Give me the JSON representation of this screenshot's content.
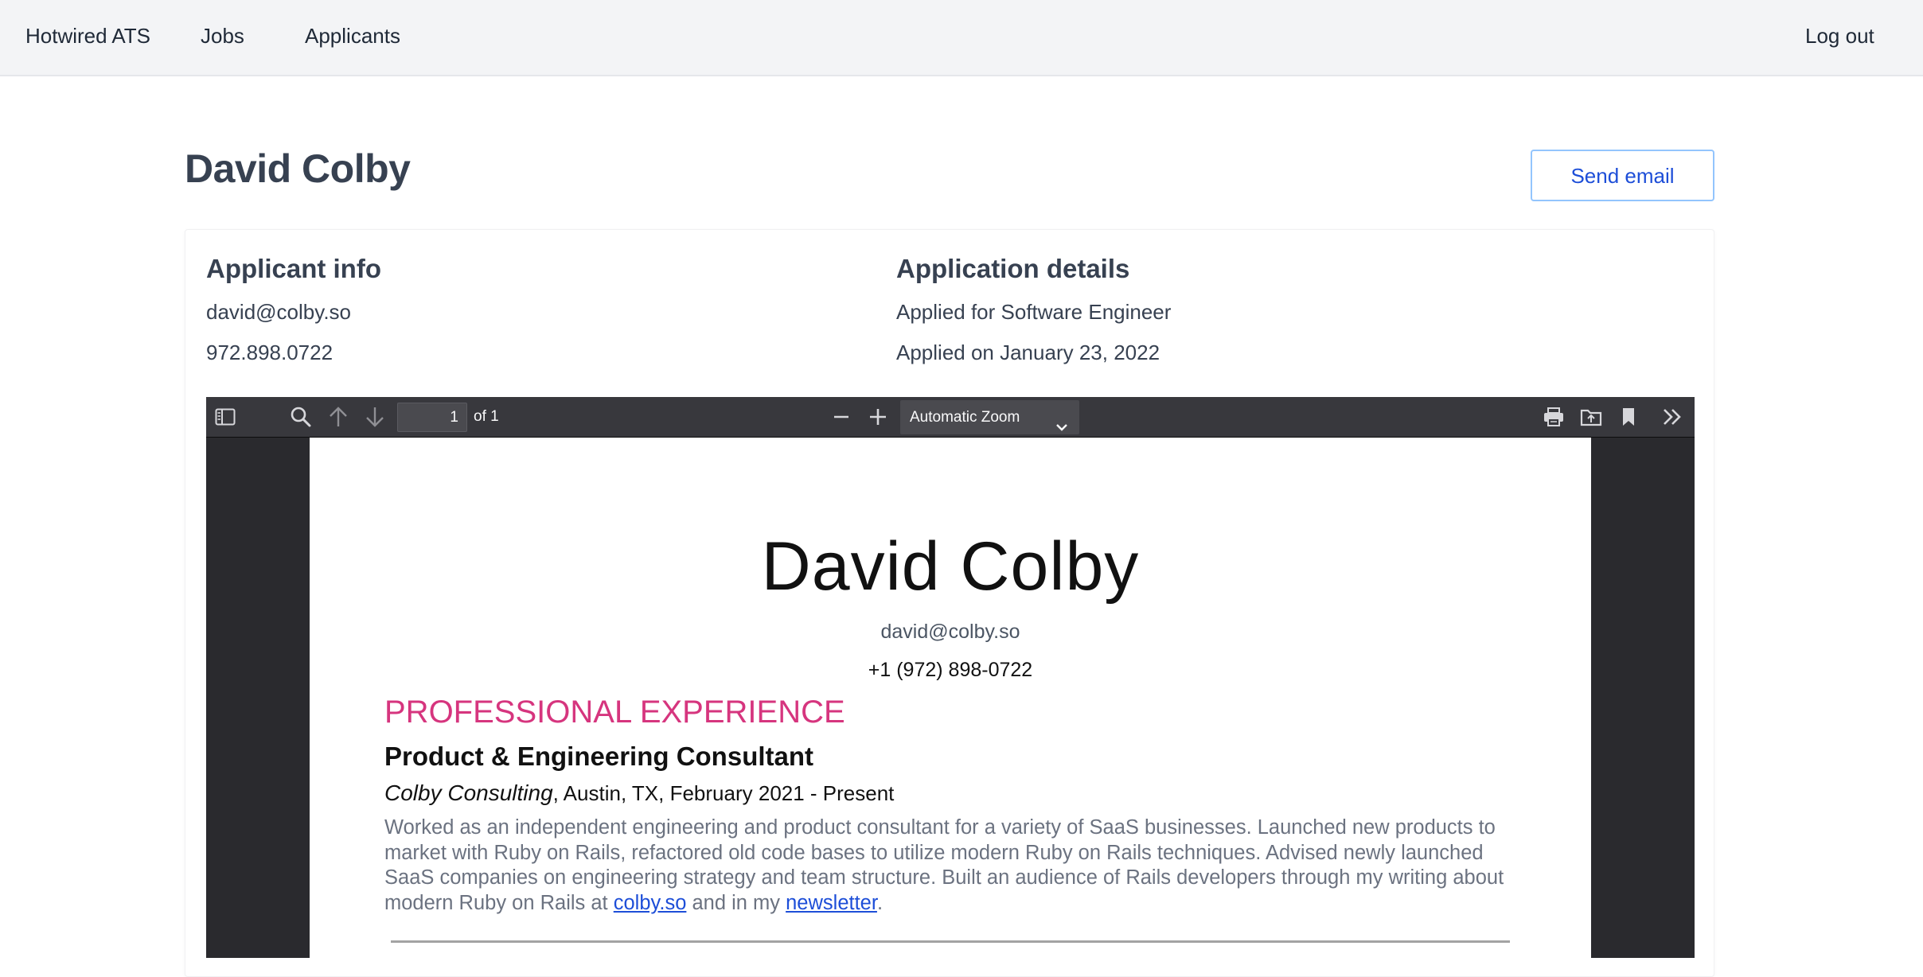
{
  "nav": {
    "brand": "Hotwired ATS",
    "jobs": "Jobs",
    "applicants": "Applicants",
    "logout": "Log out"
  },
  "header": {
    "title": "David Colby",
    "send_email_label": "Send email"
  },
  "applicant_info": {
    "heading": "Applicant info",
    "email": "david@colby.so",
    "phone": "972.898.0722"
  },
  "application_details": {
    "heading": "Application details",
    "applied_for": "Applied for Software Engineer",
    "applied_on": "Applied on January 23, 2022"
  },
  "pdf_viewer": {
    "toolbar": {
      "page_number": "1",
      "page_count": "of 1",
      "zoom_label": "Automatic Zoom",
      "icons": {
        "sidebar": "sidebar-toggle-icon",
        "search": "search-icon",
        "previous": "arrow-up-icon",
        "next": "arrow-down-icon",
        "zoom_out": "minus-icon",
        "zoom_in": "plus-icon",
        "zoom_dropdown": "chevron-down-icon",
        "print": "print-icon",
        "open": "folder-icon",
        "bookmark": "bookmark-icon",
        "tools": "double-chevron-right-icon"
      }
    },
    "document": {
      "name": "David Colby",
      "email": "david@colby.so",
      "phone": "+1 (972) 898-0722",
      "section_title": "PROFESSIONAL EXPERIENCE",
      "role": "Product & Engineering Consultant",
      "company": "Colby Consulting",
      "company_details": ", Austin, TX, February 2021 - Present",
      "description_part1": "Worked as an independent engineering and product consultant for a variety of SaaS businesses. Launched new products to market with Ruby on Rails, refactored old code bases to utilize modern Ruby on Rails techniques. Advised newly launched SaaS companies on engineering strategy and team structure. Built an audience of Rails developers through my writing about modern Ruby on Rails at ",
      "link1": "colby.so",
      "description_part2": " and in my ",
      "link2": "newsletter",
      "description_part3": "."
    }
  },
  "colors": {
    "nav_bg": "#f3f4f6",
    "heading_text": "#374151",
    "button_border": "#93c5fd",
    "button_text": "#1d4ed8",
    "pdf_toolbar": "#38383d",
    "pdf_background": "#2a2a2e",
    "resume_accent": "#d6357e",
    "link": "#1d4ed8"
  }
}
